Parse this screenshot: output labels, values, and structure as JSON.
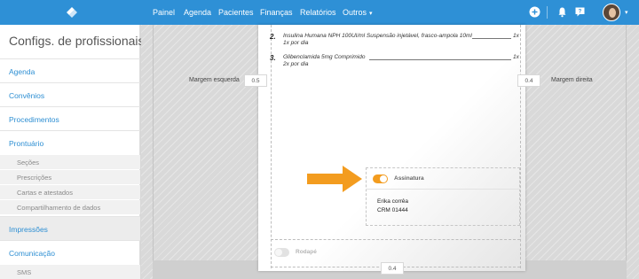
{
  "topbar": {
    "nav": [
      "Painel",
      "Agenda",
      "Pacientes",
      "Finanças",
      "Relatórios",
      "Outros"
    ],
    "icons": [
      "app-logo",
      "plus-circle-icon",
      "bell-icon",
      "help-icon",
      "avatar"
    ],
    "bar_color": "#2e90d6"
  },
  "sidebar": {
    "title": "Configs. de profissionais",
    "items": [
      {
        "label": "Agenda",
        "level": "main"
      },
      {
        "label": "Convênios",
        "level": "main"
      },
      {
        "label": "Procedimentos",
        "level": "main"
      },
      {
        "label": "Prontuário",
        "level": "main"
      },
      {
        "label": "Seções",
        "level": "sub"
      },
      {
        "label": "Prescrições",
        "level": "sub"
      },
      {
        "label": "Cartas e atestados",
        "level": "sub"
      },
      {
        "label": "Compartilhamento de dados",
        "level": "sub"
      },
      {
        "label": "Impressões",
        "level": "main",
        "active": true
      },
      {
        "label": "Comunicação",
        "level": "main"
      },
      {
        "label": "SMS",
        "level": "sub"
      }
    ]
  },
  "editor": {
    "prescriptions": [
      {
        "number": "2.",
        "name": "Insulina Humana NPH 100UI/ml Suspensão injetável, frasco-ampola 10ml",
        "qty": "1x",
        "dose": "1x por dia"
      },
      {
        "number": "3.",
        "name": "Glibenclamida 5mg Comprimido",
        "qty": "1x",
        "dose": "2x por dia"
      }
    ],
    "margins": {
      "left_label": "Margem esquerda",
      "left_value": "0.5",
      "right_label": "Margem direita",
      "right_value": "0.4",
      "bottom_value": "0.4"
    },
    "signature": {
      "toggle_label": "Assinatura",
      "enabled": true,
      "name": "Erika corrêa",
      "crm": "CRM 01444"
    },
    "footer": {
      "toggle_label": "Rodapé",
      "enabled": false
    },
    "accent_color": "#f39c1f"
  }
}
